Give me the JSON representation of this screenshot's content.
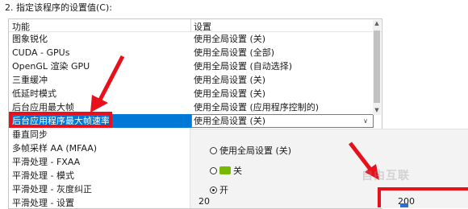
{
  "section_title": "2. 指定该程序的设置值(C):",
  "table": {
    "header_feature": "功能",
    "header_setting": "设置",
    "rows": [
      {
        "feature": "图象锐化",
        "setting": "使用全局设置 (关)"
      },
      {
        "feature": "CUDA - GPUs",
        "setting": "使用全局设置 (全部)"
      },
      {
        "feature": "OpenGL 渲染 GPU",
        "setting": "使用全局设置 (自动选择)"
      },
      {
        "feature": "三重缓冲",
        "setting": "使用全局设置 (关)"
      },
      {
        "feature": "低延时模式",
        "setting": "使用全局设置 (关)"
      },
      {
        "feature": "后台应用最大帧",
        "setting": "使用全局设置 (应用程序控制的)"
      },
      {
        "feature": "后台应用程序最大帧速率",
        "setting": "使用全局设置 (关)"
      },
      {
        "feature": "垂直同步",
        "setting": ""
      },
      {
        "feature": "多帧采样 AA (MFAA)",
        "setting": ""
      },
      {
        "feature": "平滑处理 - FXAA",
        "setting": ""
      },
      {
        "feature": "平滑处理 - 模式",
        "setting": ""
      },
      {
        "feature": "平滑处理 - 灰度纠正",
        "setting": ""
      },
      {
        "feature": "平滑处理 - 设置",
        "setting": ""
      }
    ],
    "selected_index": 6
  },
  "popup": {
    "option_global": "使用全局设置 (关)",
    "option_off": "关",
    "option_on": "开",
    "selected": "开",
    "slider_min": "20",
    "slider_max": "200"
  },
  "watermark": "自由互联",
  "colors": {
    "highlight": "#e8101b",
    "selection": "#0078d7",
    "nvidia": "#76b900"
  }
}
